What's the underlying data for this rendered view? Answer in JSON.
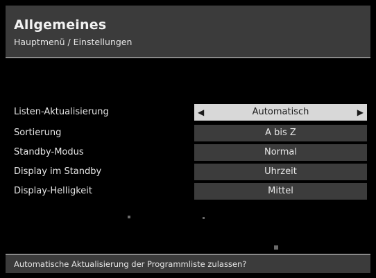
{
  "header": {
    "title": "Allgemeines",
    "breadcrumb": "Hauptmenü / Einstellungen"
  },
  "settings": [
    {
      "label": "Listen-Aktualisierung",
      "value": "Automatisch",
      "selected": true
    },
    {
      "label": "Sortierung",
      "value": "A bis Z",
      "selected": false
    },
    {
      "label": "Standby-Modus",
      "value": "Normal",
      "selected": false
    },
    {
      "label": "Display im Standby",
      "value": "Uhrzeit",
      "selected": false
    },
    {
      "label": "Display-Helligkeit",
      "value": "Mittel",
      "selected": false
    }
  ],
  "footer": {
    "help_text": "Automatische Aktualisierung der Programmliste zulassen?"
  },
  "icons": {
    "left_arrow": "left-arrow-icon",
    "right_arrow": "right-arrow-icon"
  },
  "colors": {
    "background": "#000000",
    "bar": "#3b3b3b",
    "value_box": "#3c3c3c",
    "selected_box": "#d8d8d8",
    "rule": "#8a8a8a"
  }
}
